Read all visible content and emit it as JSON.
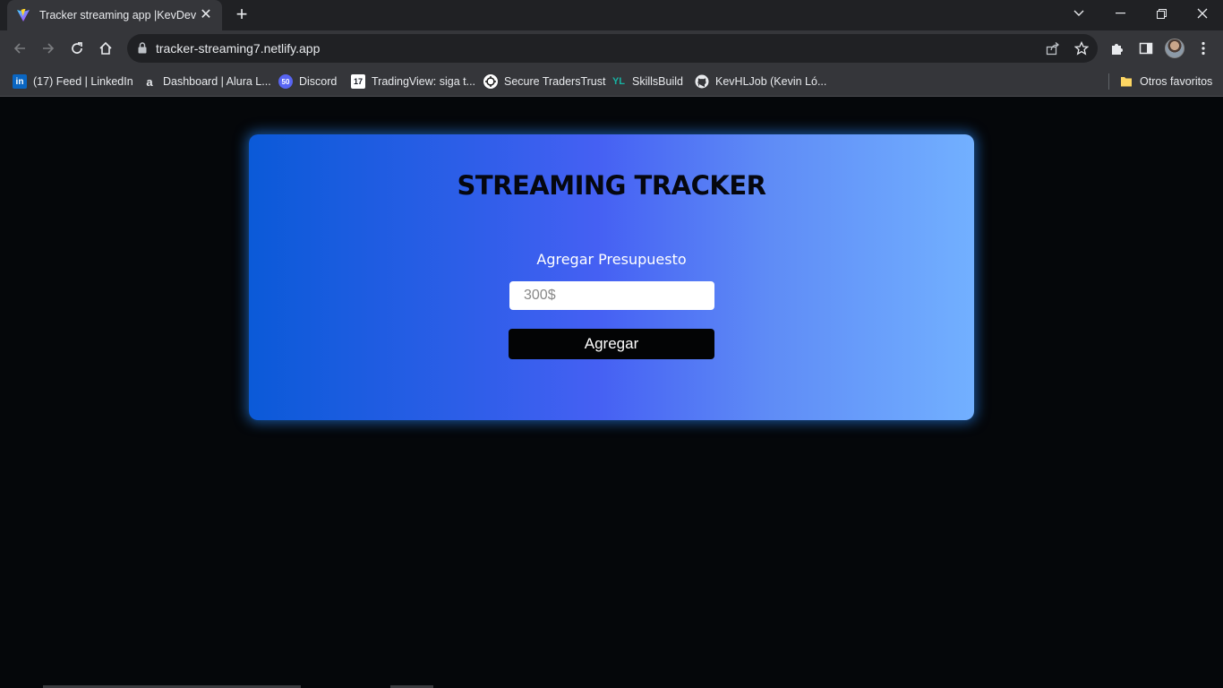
{
  "browser": {
    "tab": {
      "title": "Tracker streaming app |KevDev",
      "close_glyph": "✕"
    },
    "new_tab_glyph": "+",
    "url": "tracker-streaming7.netlify.app",
    "bookmarks": [
      {
        "label": "(17) Feed | LinkedIn",
        "icon": "linkedin-icon",
        "color": "#0a66c2"
      },
      {
        "label": "Dashboard | Alura L...",
        "icon": "alura-icon",
        "color": "#35363a"
      },
      {
        "label": "Discord",
        "icon": "discord-icon",
        "color": "#5865f2"
      },
      {
        "label": "TradingView: siga t...",
        "icon": "tradingview-icon",
        "color": "#ffffff"
      },
      {
        "label": "Secure TradersTrust",
        "icon": "traderstrust-icon",
        "color": "#ffffff"
      },
      {
        "label": "SkillsBuild",
        "icon": "skillsbuild-icon",
        "color": "#17b3a3"
      },
      {
        "label": "KevHLJob (Kevin Ló...",
        "icon": "github-icon",
        "color": "#ffffff"
      }
    ],
    "other_bookmarks": "Otros favoritos"
  },
  "page": {
    "title": "STREAMING TRACKER",
    "budget_label": "Agregar Presupuesto",
    "budget_placeholder": "300$",
    "add_button": "Agregar"
  },
  "colors": {
    "card_gradient_start": "#0b5ad8",
    "card_gradient_end": "#72b0ff",
    "page_background": "#05070a",
    "button": "#030405"
  }
}
